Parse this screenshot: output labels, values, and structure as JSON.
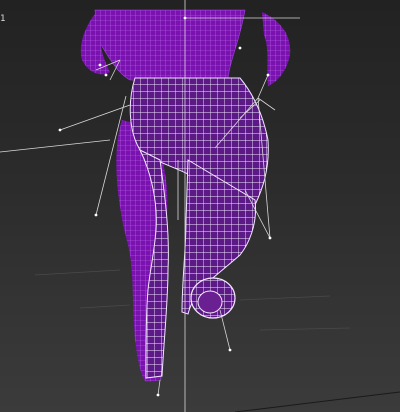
{
  "viewport": {
    "label": "1",
    "wire_color_front": "#ffffff",
    "wire_color_back": "#8a1fb8",
    "background": "#2f2f2f"
  }
}
